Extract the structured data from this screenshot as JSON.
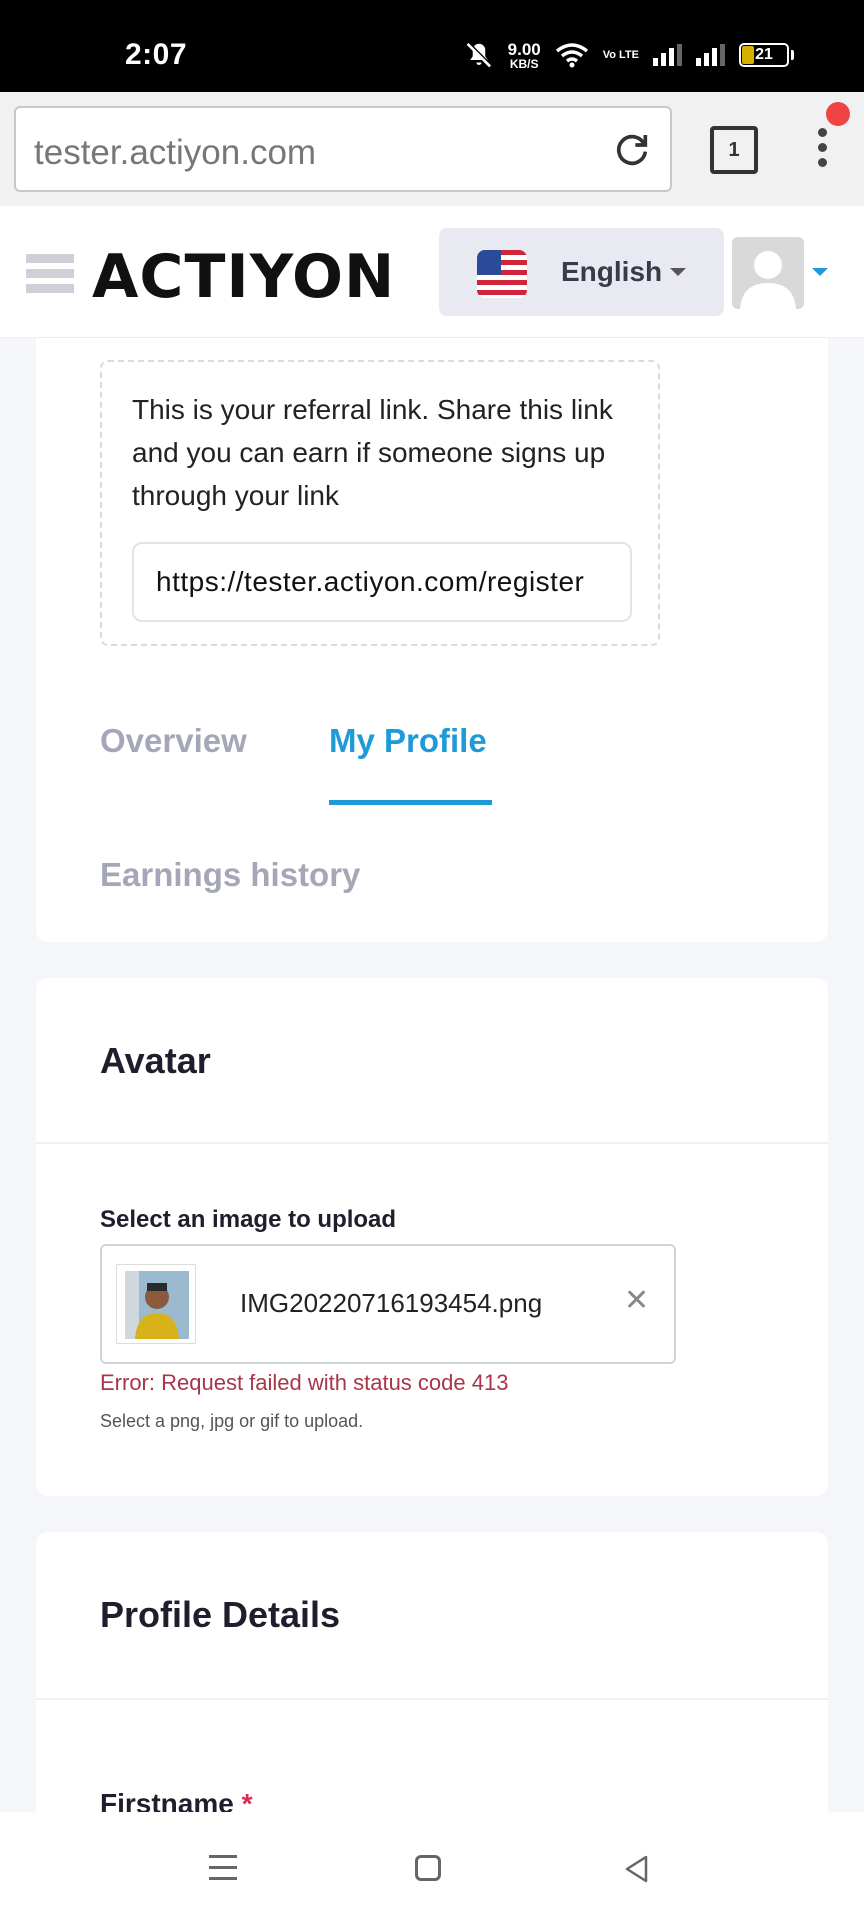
{
  "status_bar": {
    "time": "2:07",
    "net_speed": "9.00",
    "net_unit": "KB/S",
    "lte": "Vo LTE",
    "battery": "21"
  },
  "browser": {
    "url": "tester.actiyon.com",
    "tab_count": "1"
  },
  "header": {
    "logo": "ACTIYON",
    "language": "English"
  },
  "referral": {
    "description": "This is your referral link. Share this link and you can earn if someone signs up through your link",
    "link": "https://tester.actiyon.com/register"
  },
  "tabs": [
    {
      "label": "Overview",
      "active": false
    },
    {
      "label": "My Profile",
      "active": true
    },
    {
      "label": "Earnings history",
      "active": false
    }
  ],
  "avatar_section": {
    "title": "Avatar",
    "field_label": "Select an image to upload",
    "file_name": "IMG20220716193454.png",
    "error": "Error: Request failed with status code 413",
    "hint": "Select a png, jpg or gif to upload."
  },
  "profile_details": {
    "title": "Profile Details",
    "firstname_label": "Firstname",
    "required_mark": "*"
  },
  "colors": {
    "accent": "#1e9bd7",
    "error": "#a8364a",
    "muted_tab": "#a5a7b8"
  }
}
